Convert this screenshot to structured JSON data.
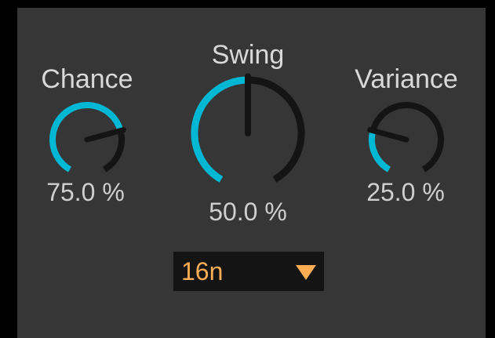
{
  "colors": {
    "background": "#363636",
    "outer": "#000000",
    "accent": "#00b8d4",
    "track": "#141414",
    "label": "#d9d9d9",
    "value": "#cfcfcf",
    "dropdown_text": "#ffad55"
  },
  "knobs": [
    {
      "id": "chance",
      "label": "Chance",
      "value_text": "75.0 %",
      "fraction": 0.75
    },
    {
      "id": "swing",
      "label": "Swing",
      "value_text": "50.0 %",
      "fraction": 0.5
    },
    {
      "id": "variance",
      "label": "Variance",
      "value_text": "25.0 %",
      "fraction": 0.25
    }
  ],
  "rate_dropdown": {
    "selected": "16n",
    "arrow_icon": "triangle-down-icon"
  }
}
